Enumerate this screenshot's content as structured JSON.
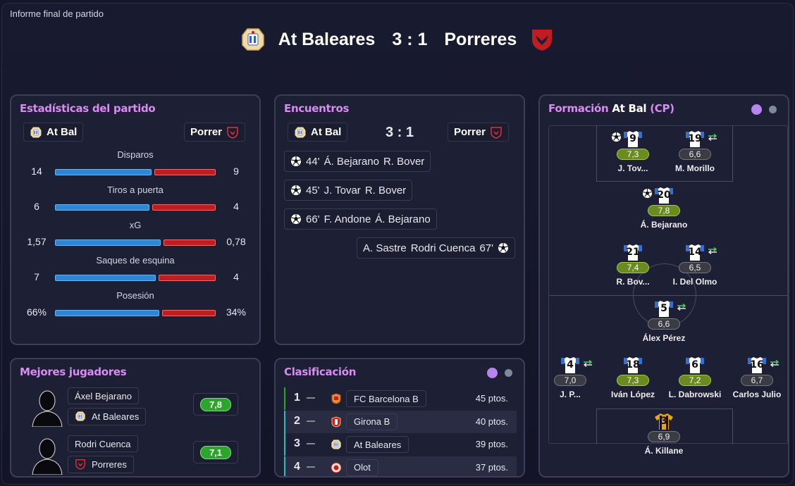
{
  "window_title": "Informe final de partido",
  "header": {
    "home_team": "At Baleares",
    "score": "3 : 1",
    "away_team": "Porreres"
  },
  "colors": {
    "accent_title": "#d98cf0",
    "home_bar": "#2e86d6",
    "away_bar": "#c01d22",
    "rating_green": "#2da52d"
  },
  "stats_panel": {
    "title": "Estadísticas del partido",
    "home_chip": "At Bal",
    "away_chip": "Porrer",
    "stats": [
      {
        "label": "Disparos",
        "home": "14",
        "away": "9",
        "home_share": 0.61
      },
      {
        "label": "Tiros a puerta",
        "home": "6",
        "away": "4",
        "home_share": 0.6
      },
      {
        "label": "xG",
        "home": "1,57",
        "away": "0,78",
        "home_share": 0.67
      },
      {
        "label": "Saques de esquina",
        "home": "7",
        "away": "4",
        "home_share": 0.64
      },
      {
        "label": "Posesión",
        "home": "66%",
        "away": "34%",
        "home_share": 0.66
      }
    ]
  },
  "events_panel": {
    "title": "Encuentros",
    "home_chip": "At Bal",
    "away_chip": "Porrer",
    "score": "3 : 1",
    "events": [
      {
        "minute": "44'",
        "scorer": "Á. Bejarano",
        "assist": "R. Bover",
        "side": "home"
      },
      {
        "minute": "45'",
        "scorer": "J. Tovar",
        "assist": "R. Bover",
        "side": "home"
      },
      {
        "minute": "66'",
        "scorer": "F. Andone",
        "assist": "Á. Bejarano",
        "side": "home"
      },
      {
        "minute": "67'",
        "scorer": "Rodri Cuenca",
        "assist": "A. Sastre",
        "side": "away"
      }
    ]
  },
  "best_players": {
    "title": "Mejores jugadores",
    "players": [
      {
        "name": "Áxel Bejarano",
        "team": "At Baleares",
        "rating": "7,8"
      },
      {
        "name": "Rodri Cuenca",
        "team": "Porreres",
        "rating": "7,1"
      }
    ]
  },
  "table_panel": {
    "title": "Clasificación",
    "rows": [
      {
        "pos": "1",
        "team": "FC Barcelona B",
        "pts": "45 ptos.",
        "accent": "#2da52d"
      },
      {
        "pos": "2",
        "team": "Girona B",
        "pts": "40 ptos.",
        "accent": "#2fb7c0"
      },
      {
        "pos": "3",
        "team": "At Baleares",
        "pts": "39 ptos.",
        "accent": "#2fb7c0"
      },
      {
        "pos": "4",
        "team": "Olot",
        "pts": "37 ptos.",
        "accent": "#2fb7c0"
      }
    ]
  },
  "formation_panel": {
    "title_prefix": "Formación",
    "team": "At Bal",
    "suffix": "(CP)",
    "players": [
      {
        "num": "9",
        "name": "J. Tov...",
        "rating": "7,3",
        "good": true,
        "goal": true,
        "swap": false
      },
      {
        "num": "19",
        "name": "M. Morillo",
        "rating": "6,6",
        "good": false,
        "goal": false,
        "swap": true
      },
      {
        "num": "20",
        "name": "Á. Bejarano",
        "rating": "7,8",
        "good": true,
        "goal": true,
        "swap": false
      },
      {
        "num": "21",
        "name": "R. Bov...",
        "rating": "7,4",
        "good": true,
        "goal": false,
        "swap": false
      },
      {
        "num": "14",
        "name": "I. Del Olmo",
        "rating": "6,5",
        "good": false,
        "goal": false,
        "swap": true
      },
      {
        "num": "5",
        "name": "Álex Pérez",
        "rating": "6,6",
        "good": false,
        "goal": false,
        "swap": true
      },
      {
        "num": "4",
        "name": "J. P...",
        "rating": "7,0",
        "good": false,
        "goal": false,
        "swap": true
      },
      {
        "num": "18",
        "name": "Iván López",
        "rating": "7,3",
        "good": true,
        "goal": false,
        "swap": false
      },
      {
        "num": "6",
        "name": "L. Dabrowski",
        "rating": "7,2",
        "good": true,
        "goal": false,
        "swap": false
      },
      {
        "num": "16",
        "name": "Carlos Julio",
        "rating": "6,7",
        "good": false,
        "goal": false,
        "swap": true
      },
      {
        "num": "3",
        "name": "Á. Killane",
        "rating": "6,9",
        "good": false,
        "goal": false,
        "swap": false
      }
    ]
  }
}
